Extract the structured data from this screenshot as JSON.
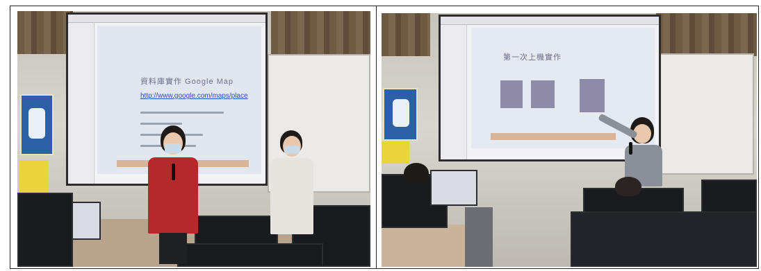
{
  "photos": [
    {
      "name": "left-photo",
      "screen_slide": {
        "title": "資料庫實作 Google Map",
        "link": "http://www.google.com/maps/place"
      }
    },
    {
      "name": "right-photo",
      "screen_slide": {
        "title": "第一次上機實作"
      }
    }
  ],
  "colors": {
    "frame_border": "#222222",
    "speaker_shirt_left": "#b5282c",
    "speaker_shirt_right": "#8a8f98",
    "second_person_shirt": "#e7e4df",
    "screen_bar": "#d8b498"
  }
}
